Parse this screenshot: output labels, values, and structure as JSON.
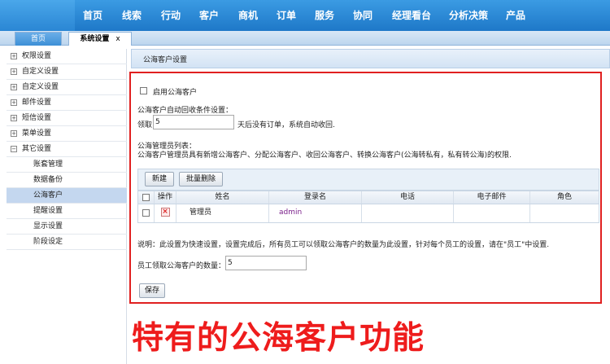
{
  "nav": {
    "items": [
      {
        "label": "首页"
      },
      {
        "label": "线索"
      },
      {
        "label": "行动"
      },
      {
        "label": "客户"
      },
      {
        "label": "商机"
      },
      {
        "label": "订单"
      },
      {
        "label": "服务"
      },
      {
        "label": "协同"
      },
      {
        "label": "经理看台"
      },
      {
        "label": "分析决策"
      },
      {
        "label": "产品"
      }
    ]
  },
  "tabs": {
    "home": "首页",
    "system_settings": "系统设置",
    "close": "x"
  },
  "sidebar": {
    "groups": [
      {
        "label": "权限设置",
        "icon": "plus"
      },
      {
        "label": "自定义设置",
        "icon": "plus"
      },
      {
        "label": "自定义设置",
        "icon": "plus"
      },
      {
        "label": "邮件设置",
        "icon": "plus"
      },
      {
        "label": "短信设置",
        "icon": "plus"
      },
      {
        "label": "菜单设置",
        "icon": "plus"
      },
      {
        "label": "其它设置",
        "icon": "minus"
      }
    ],
    "sub_items": [
      {
        "label": "账套管理"
      },
      {
        "label": "数据备份"
      },
      {
        "label": "公海客户",
        "active": true
      },
      {
        "label": "提醒设置"
      },
      {
        "label": "显示设置"
      },
      {
        "label": "阶段设定"
      }
    ]
  },
  "panel": {
    "title": "公海客户设置",
    "enable_label": "启用公海客户",
    "auto_recycle_title": "公海客户自动回收条件设置：",
    "receive_label": "领取",
    "receive_days": "5",
    "receive_suffix": "天后没有订单，系统自动收回.",
    "admin_list_title": "公海管理员列表：",
    "admin_list_desc": "公海客户管理员具有新增公海客户、分配公海客户、收回公海客户、转换公海客户(公海转私有，私有转公海)的权限.",
    "new_button": "新建",
    "batch_delete_button": "批量删除",
    "table": {
      "columns": [
        "操作",
        "姓名",
        "登录名",
        "电话",
        "电子邮件",
        "角色"
      ],
      "rows": [
        {
          "name": "管理员",
          "login": "admin",
          "phone": "",
          "email": "",
          "role": ""
        }
      ]
    },
    "note": "说明：此设置为快速设置，设置完成后，所有员工可以领取公海客户的数量为此设置，针对每个员工的设置，请在\"员工\"中设置.",
    "quota_label": "员工领取公海客户的数量：",
    "quota_value": "5",
    "save_button": "保存"
  },
  "caption": "特有的公海客户功能",
  "colors": {
    "nav_blue": "#1e78c8",
    "highlight_red": "#e02020",
    "caption_red": "#ee1c1c",
    "login_link": "#7a1f8a"
  }
}
